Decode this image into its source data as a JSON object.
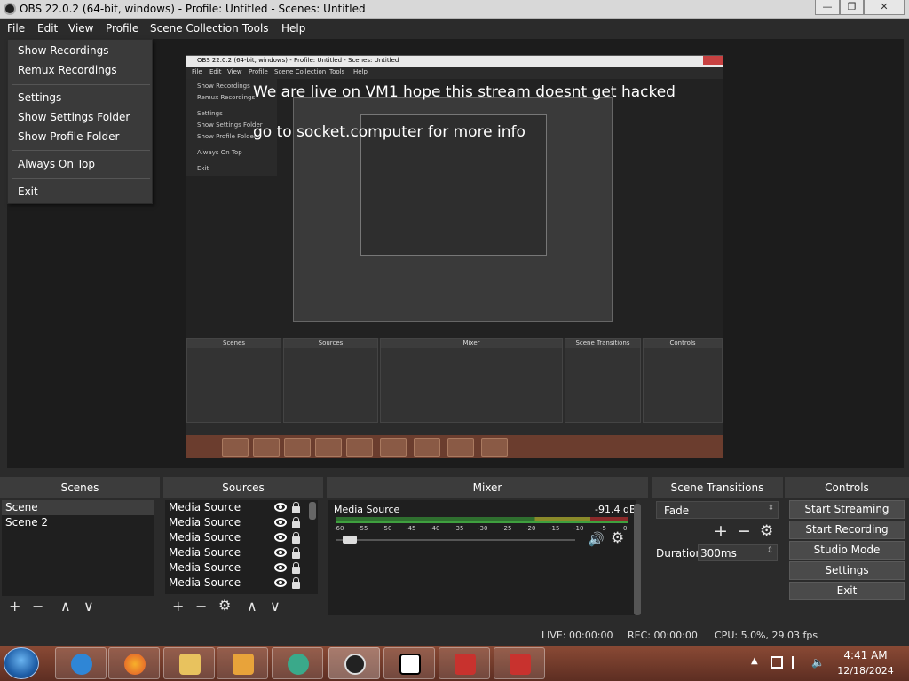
{
  "window": {
    "title": "OBS 22.0.2 (64-bit, windows) - Profile: Untitled - Scenes: Untitled",
    "minimize": "—",
    "maximize": "❐",
    "close": "✕"
  },
  "menubar": [
    "File",
    "Edit",
    "View",
    "Profile",
    "Scene Collection",
    "Tools",
    "Help"
  ],
  "file_menu": {
    "items": [
      "Show Recordings",
      "Remux Recordings",
      "Settings",
      "Show Settings Folder",
      "Show Profile Folder",
      "Always On Top",
      "Exit"
    ]
  },
  "preview": {
    "nested_title": "OBS 22.0.2 (64-bit, windows) - Profile: Untitled - Scenes: Untitled",
    "nested_menu": [
      "File",
      "Edit",
      "View",
      "Profile",
      "Scene Collection",
      "Tools",
      "Help"
    ],
    "nested_submenu": [
      "Show Recordings",
      "Remux Recordings",
      "Settings",
      "Show Settings Folder",
      "Show Profile Folder",
      "Always On Top",
      "Exit"
    ],
    "nested_docks": [
      "Scenes",
      "Sources",
      "Mixer",
      "Scene Transitions",
      "Controls"
    ],
    "overlay_text_1": "We are live on VM1 hope this stream doesnt get hacked",
    "overlay_text_2": "go to socket.computer for more info"
  },
  "scenes": {
    "title": "Scenes",
    "items": [
      "Scene",
      "Scene 2"
    ],
    "toolbar": [
      "+",
      "−",
      "∧",
      "∨"
    ]
  },
  "sources": {
    "title": "Sources",
    "items": [
      "Media Source",
      "Media Source",
      "Media Source",
      "Media Source",
      "Media Source",
      "Media Source"
    ],
    "toolbar": [
      "+",
      "−",
      "⚙",
      "∧",
      "∨"
    ]
  },
  "mixer": {
    "title": "Mixer",
    "source": "Media Source",
    "level": "-91.4 dB",
    "ticks": [
      "-60",
      "-55",
      "-50",
      "-45",
      "-40",
      "-35",
      "-30",
      "-25",
      "-20",
      "-15",
      "-10",
      "-5",
      "0"
    ]
  },
  "transitions": {
    "title": "Scene Transitions",
    "selected": "Fade",
    "duration_label": "Duration",
    "duration_value": "300ms"
  },
  "controls": {
    "title": "Controls",
    "buttons": [
      "Start Streaming",
      "Start Recording",
      "Studio Mode",
      "Settings",
      "Exit"
    ]
  },
  "status": {
    "live": "LIVE: 00:00:00",
    "rec": "REC: 00:00:00",
    "cpu": "CPU: 5.0%, 29.03 fps"
  },
  "taskbar": {
    "apps": [
      "internet-explorer",
      "firefox",
      "file-explorer",
      "media-player",
      "chat-app",
      "obs",
      "7zip",
      "toolbox-1",
      "toolbox-2"
    ],
    "time": "4:41 AM",
    "date": "12/18/2024"
  },
  "colors": {
    "accent": "#3c3c3c",
    "close": "#c74141",
    "meter_green": "#3fa03f",
    "meter_yellow": "#b5b53a",
    "meter_red": "#b54040"
  }
}
